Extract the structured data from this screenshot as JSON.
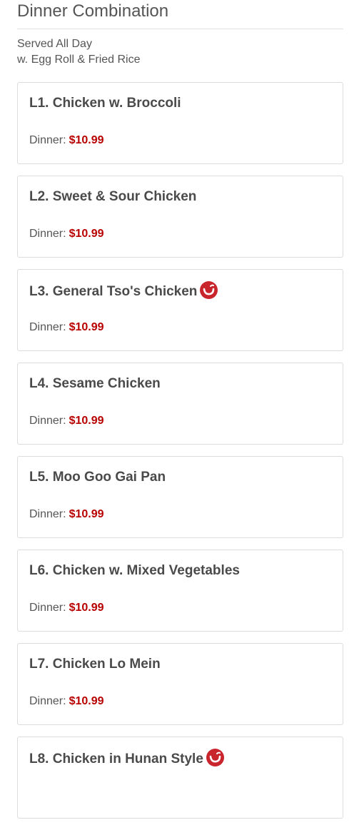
{
  "section": {
    "title": "Dinner Combination",
    "subtitle_line1": "Served All Day",
    "subtitle_line2": "w. Egg Roll & Fried Rice"
  },
  "price_label": "Dinner:",
  "items": [
    {
      "name": "L1. Chicken w. Broccoli",
      "price": "$10.99",
      "spicy": false
    },
    {
      "name": "L2. Sweet & Sour Chicken",
      "price": "$10.99",
      "spicy": false
    },
    {
      "name": "L3. General Tso's Chicken",
      "price": "$10.99",
      "spicy": true
    },
    {
      "name": "L4. Sesame Chicken",
      "price": "$10.99",
      "spicy": false
    },
    {
      "name": "L5. Moo Goo Gai Pan",
      "price": "$10.99",
      "spicy": false
    },
    {
      "name": "L6. Chicken w. Mixed Vegetables",
      "price": "$10.99",
      "spicy": false
    },
    {
      "name": "L7. Chicken Lo Mein",
      "price": "$10.99",
      "spicy": false
    },
    {
      "name": "L8. Chicken in Hunan Style",
      "price": "",
      "spicy": true
    }
  ],
  "colors": {
    "price": "#b80000",
    "spicy_badge": "#c8262c"
  }
}
